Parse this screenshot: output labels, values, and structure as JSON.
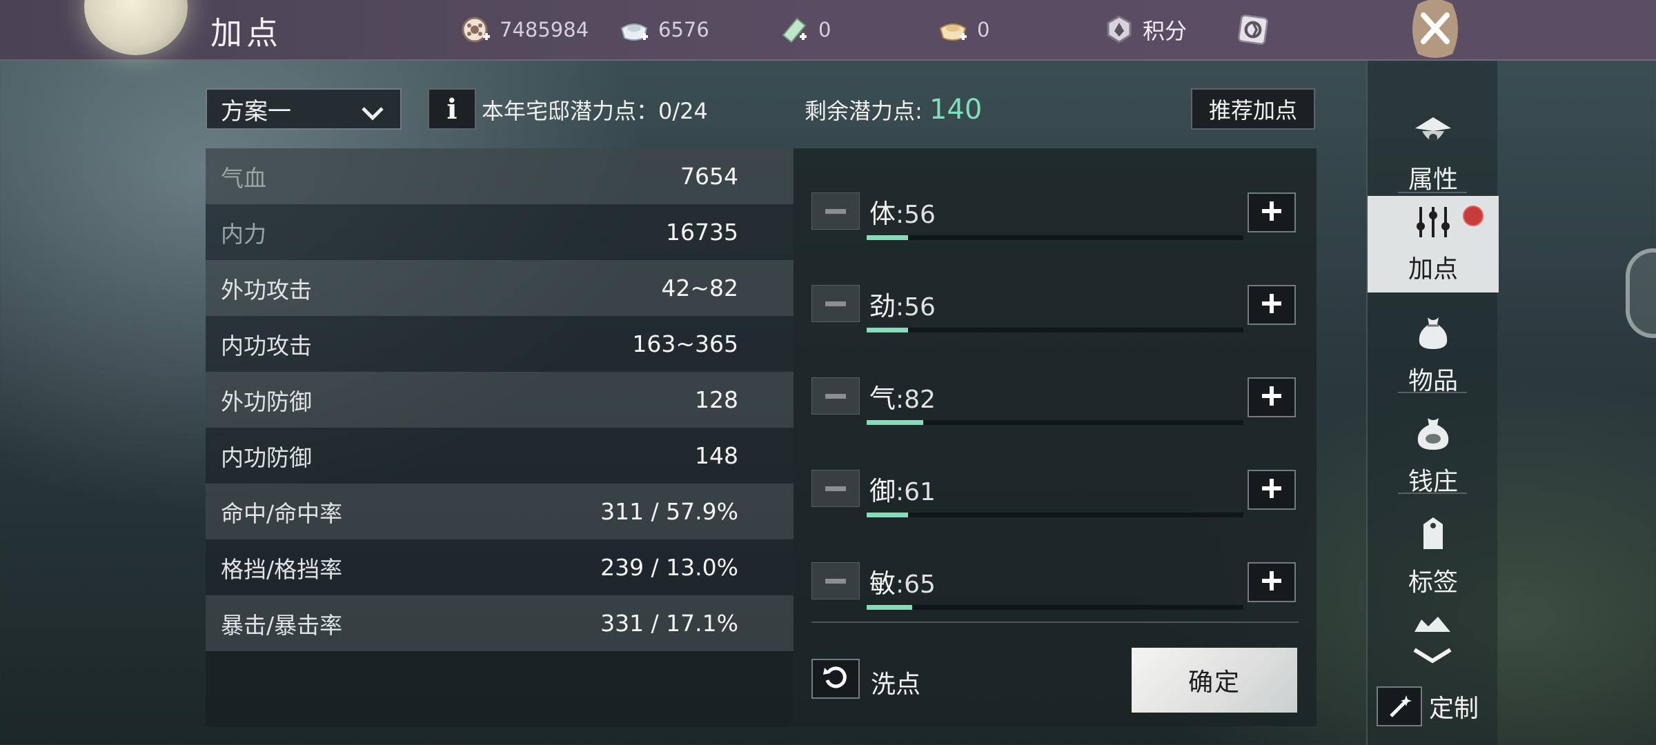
{
  "header": {
    "title": "加点",
    "resources": [
      {
        "icon": "coin-reel-icon",
        "value": "7485984"
      },
      {
        "icon": "silver-ingot-icon",
        "value": "6576"
      },
      {
        "icon": "jade-ticket-icon",
        "value": "0"
      },
      {
        "icon": "gold-ingot-icon",
        "value": "0"
      }
    ],
    "points_label": "积分",
    "points_icon": "points-badge-icon",
    "settings_icon": "emblem-icon",
    "close_icon": "close-icon"
  },
  "toolbar": {
    "scheme_value": "方案一",
    "info_label": "i",
    "mansion_potential_label": "本年宅邸潜力点：0/24",
    "remaining_label": "剩余潜力点:",
    "remaining_value": "140",
    "recommend_label": "推荐加点"
  },
  "stats": [
    {
      "name": "气血",
      "value": "7654"
    },
    {
      "name": "内力",
      "value": "16735"
    },
    {
      "name": "外功攻击",
      "value": "42~82"
    },
    {
      "name": "内功攻击",
      "value": "163~365"
    },
    {
      "name": "外功防御",
      "value": "128"
    },
    {
      "name": "内功防御",
      "value": "148"
    },
    {
      "name": "命中/命中率",
      "value": "311 / 57.9%"
    },
    {
      "name": "格挡/格挡率",
      "value": "239 / 13.0%"
    },
    {
      "name": "暴击/暴击率",
      "value": "331 / 17.1%"
    }
  ],
  "attributes": [
    {
      "name": "体",
      "sep": ":",
      "value": "56",
      "bar_fraction": 0.11
    },
    {
      "name": "劲",
      "sep": ":",
      "value": "56",
      "bar_fraction": 0.11
    },
    {
      "name": "气",
      "sep": ":",
      "value": "82",
      "bar_fraction": 0.15
    },
    {
      "name": "御",
      "sep": ":",
      "value": "61",
      "bar_fraction": 0.11
    },
    {
      "name": "敏",
      "sep": ":",
      "value": "65",
      "bar_fraction": 0.12
    }
  ],
  "actions": {
    "reset_label": "洗点",
    "confirm_label": "确定"
  },
  "sidebar": {
    "items": [
      {
        "label": "属性",
        "icon": "hat-icon",
        "active": false
      },
      {
        "label": "加点",
        "icon": "sliders-icon",
        "active": true
      },
      {
        "label": "物品",
        "icon": "bag-icon",
        "active": false
      },
      {
        "label": "钱庄",
        "icon": "money-bag-icon",
        "active": false
      },
      {
        "label": "标签",
        "icon": "tag-icon",
        "active": false
      }
    ],
    "more_icon": "chevron-down-icon",
    "custom_label": "定制"
  },
  "colors": {
    "accent": "#7fe0b8",
    "topbar": "#564a5f",
    "notification": "#c93a3a"
  }
}
